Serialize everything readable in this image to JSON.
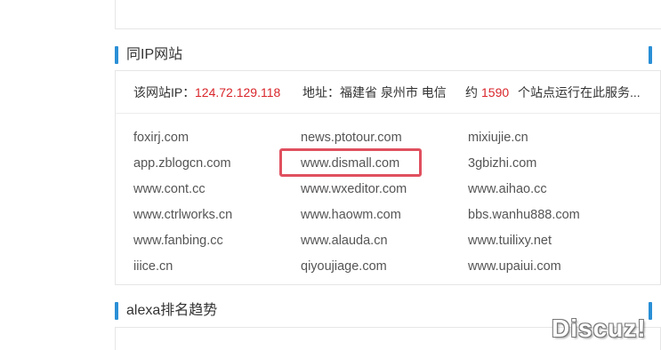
{
  "ip_section": {
    "title": "同IP网站",
    "ip_label": "该网站IP：",
    "ip_value": "124.72.129.118",
    "addr_label": "地址：",
    "addr_value": "福建省 泉州市 电信",
    "count_prefix": "约",
    "count_value": "1590",
    "count_suffix": "个站点运行在此服务...",
    "sites": [
      [
        "foxirj.com",
        "news.ptotour.com",
        "mixiujie.cn"
      ],
      [
        "app.zblogcn.com",
        "www.dismall.com",
        "3gbizhi.com"
      ],
      [
        "www.cont.cc",
        "www.wxeditor.com",
        "www.aihao.cc"
      ],
      [
        "www.ctrlworks.cn",
        "www.haowm.com",
        "bbs.wanhu888.com"
      ],
      [
        "www.fanbing.cc",
        "www.alauda.cn",
        "www.tuilixy.net"
      ],
      [
        "iiice.cn",
        "qiyoujiage.com",
        "www.upaiui.com"
      ]
    ]
  },
  "alexa_section": {
    "title": "alexa排名趋势"
  },
  "watermark": "Discuz!",
  "colors": {
    "accent_bar": "#2a8fd6",
    "highlight_value": "#d9262b",
    "highlight_box": "#e0505f"
  }
}
